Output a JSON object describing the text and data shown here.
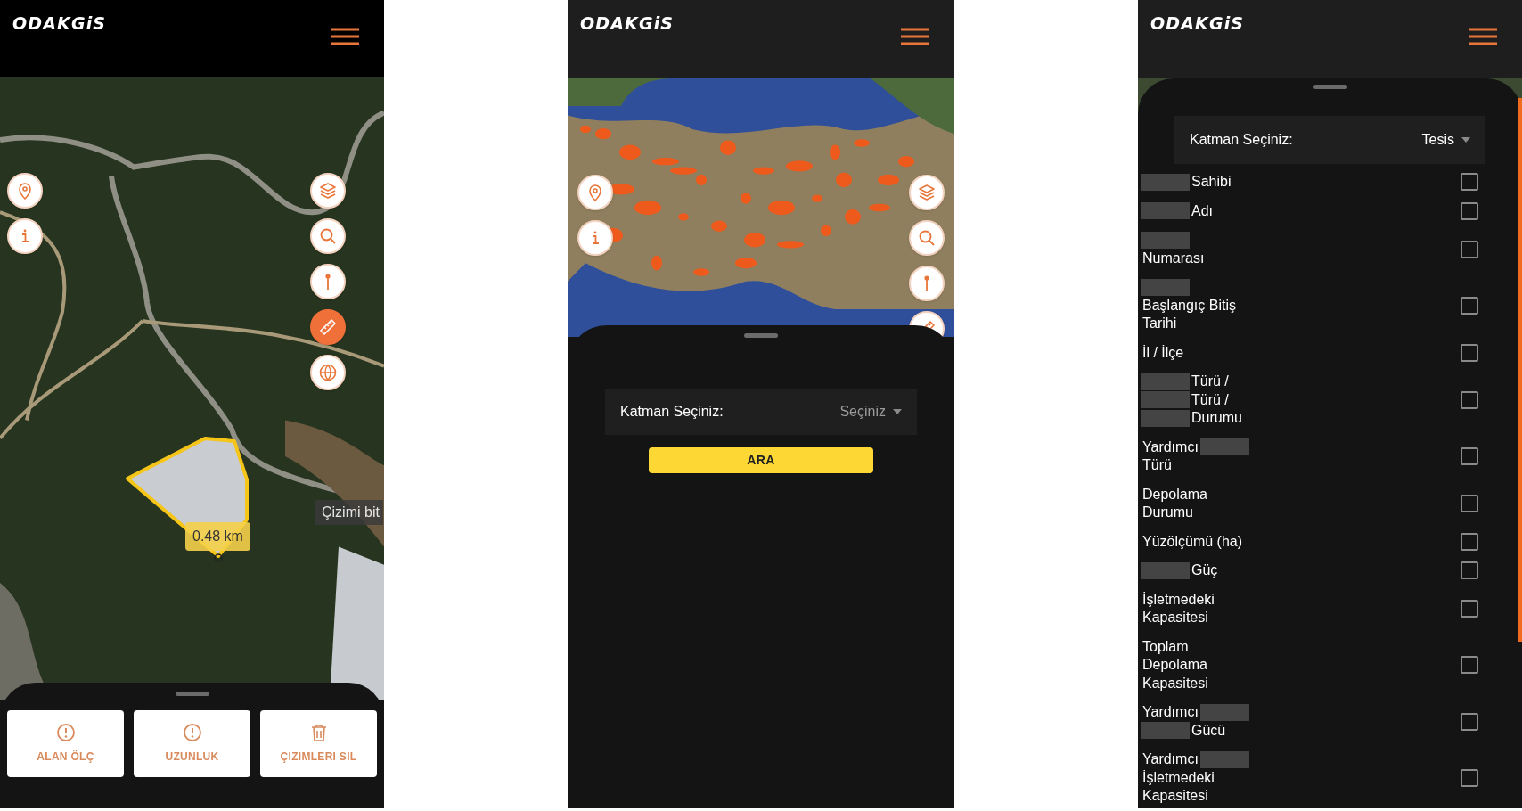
{
  "screens": [
    {
      "kind": "draw",
      "header": {
        "logo": "ODAKGiS"
      },
      "map": {
        "kind": "forest",
        "left_tools": [
          {
            "kind": "pin",
            "active": false
          },
          {
            "kind": "info",
            "active": false
          }
        ],
        "right_tools": [
          {
            "kind": "layers",
            "active": false
          },
          {
            "kind": "search",
            "active": false
          },
          {
            "kind": "marker",
            "active": false
          },
          {
            "kind": "ruler",
            "active": true
          },
          {
            "kind": "globe",
            "active": false
          }
        ],
        "measurement": "0.48 km",
        "tooltip": "Çizimi bit"
      },
      "actions": [
        {
          "kind": "alert",
          "label": "ALAN ÖLÇ"
        },
        {
          "kind": "alert",
          "label": "UZUNLUK"
        },
        {
          "kind": "trash",
          "label": "ÇIZIMLERI SIL"
        }
      ]
    },
    {
      "kind": "search",
      "header": {
        "logo": "ODAKGiS"
      },
      "map": {
        "kind": "country",
        "left_tools": [
          {
            "kind": "pin",
            "active": false
          },
          {
            "kind": "info",
            "active": false
          }
        ],
        "right_tools": [
          {
            "kind": "layers",
            "active": false
          },
          {
            "kind": "search",
            "active": false
          },
          {
            "kind": "marker",
            "active": false
          },
          {
            "kind": "ruler",
            "active": false
          }
        ]
      },
      "layer_select": {
        "label": "Katman Seçiniz:",
        "placeholder": "Seçiniz"
      },
      "search_button": "ARA"
    },
    {
      "kind": "layers",
      "header": {
        "logo": "ODAKGiS"
      },
      "layer_select": {
        "label": "Katman Seçiniz:",
        "value": "Tesis"
      },
      "fields": [
        {
          "checked": false,
          "lines": [
            [
              {
                "kind": "redacted"
              },
              {
                "kind": "text",
                "text": "Sahibi"
              }
            ]
          ]
        },
        {
          "checked": false,
          "lines": [
            [
              {
                "kind": "redacted"
              },
              {
                "kind": "text",
                "text": "Adı"
              }
            ]
          ]
        },
        {
          "checked": false,
          "lines": [
            [
              {
                "kind": "redacted"
              }
            ],
            [
              {
                "kind": "text",
                "text": "Numarası"
              }
            ]
          ]
        },
        {
          "checked": false,
          "lines": [
            [
              {
                "kind": "redacted"
              }
            ],
            [
              {
                "kind": "text",
                "text": "Başlangıç Bitiş"
              }
            ],
            [
              {
                "kind": "text",
                "text": "Tarihi"
              }
            ]
          ]
        },
        {
          "checked": false,
          "lines": [
            [
              {
                "kind": "text",
                "text": "İl / İlçe"
              }
            ]
          ]
        },
        {
          "checked": false,
          "lines": [
            [
              {
                "kind": "redacted"
              },
              {
                "kind": "text",
                "text": "Türü /"
              }
            ],
            [
              {
                "kind": "redacted"
              },
              {
                "kind": "text",
                "text": "Türü /"
              }
            ],
            [
              {
                "kind": "redacted"
              },
              {
                "kind": "text",
                "text": "Durumu"
              }
            ]
          ]
        },
        {
          "checked": false,
          "lines": [
            [
              {
                "kind": "text",
                "text": "Yardımcı"
              },
              {
                "kind": "redacted"
              }
            ],
            [
              {
                "kind": "text",
                "text": "Türü"
              }
            ]
          ]
        },
        {
          "checked": false,
          "lines": [
            [
              {
                "kind": "text",
                "text": "Depolama"
              }
            ],
            [
              {
                "kind": "text",
                "text": "Durumu"
              }
            ]
          ]
        },
        {
          "checked": false,
          "lines": [
            [
              {
                "kind": "text",
                "text": "Yüzölçümü (ha)"
              }
            ]
          ]
        },
        {
          "checked": false,
          "lines": [
            [
              {
                "kind": "redacted"
              },
              {
                "kind": "text",
                "text": "Güç"
              }
            ]
          ]
        },
        {
          "checked": false,
          "lines": [
            [
              {
                "kind": "text",
                "text": "İşletmedeki"
              }
            ],
            [
              {
                "kind": "text",
                "text": "Kapasitesi"
              }
            ]
          ]
        },
        {
          "checked": false,
          "lines": [
            [
              {
                "kind": "text",
                "text": "Toplam"
              }
            ],
            [
              {
                "kind": "text",
                "text": "Depolama"
              }
            ],
            [
              {
                "kind": "text",
                "text": "Kapasitesi"
              }
            ]
          ]
        },
        {
          "checked": false,
          "lines": [
            [
              {
                "kind": "text",
                "text": "Yardımcı"
              },
              {
                "kind": "redacted"
              }
            ],
            [
              {
                "kind": "redacted"
              },
              {
                "kind": "text",
                "text": "Gücü"
              }
            ]
          ]
        },
        {
          "checked": false,
          "lines": [
            [
              {
                "kind": "text",
                "text": "Yardımcı"
              },
              {
                "kind": "redacted"
              }
            ],
            [
              {
                "kind": "text",
                "text": "İşletmedeki"
              }
            ],
            [
              {
                "kind": "text",
                "text": "Kapasitesi"
              }
            ]
          ]
        }
      ]
    }
  ]
}
